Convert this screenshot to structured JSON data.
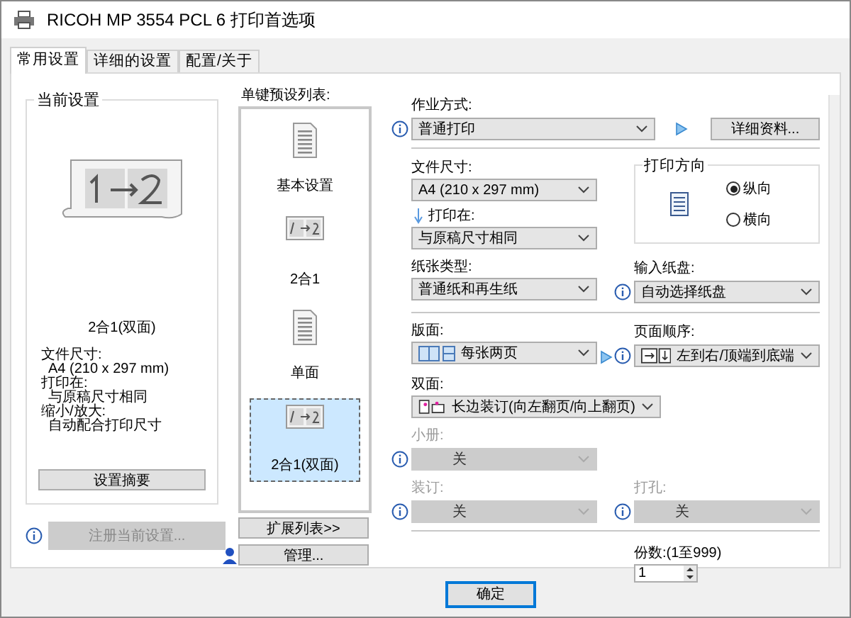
{
  "window": {
    "title": "RICOH MP 3554 PCL 6 打印首选项"
  },
  "tabs": [
    {
      "label": "常用设置",
      "selected": true
    },
    {
      "label": "详细的设置",
      "selected": false
    },
    {
      "label": "配置/关于",
      "selected": false
    }
  ],
  "current_settings": {
    "title": "当前设置",
    "caption": "2合1(双面)",
    "details": [
      {
        "label": "文件尺寸:",
        "value": "A4 (210 x 297 mm)"
      },
      {
        "label": "打印在:",
        "value": "与原稿尺寸相同"
      },
      {
        "label": "缩小/放大:",
        "value": "自动配合打印尺寸"
      }
    ],
    "summary_button": "设置摘要"
  },
  "register_button": {
    "label": "注册当前设置...",
    "disabled": true
  },
  "preset_list": {
    "title": "单键预设列表:",
    "items": [
      {
        "label": "基本设置",
        "kind": "document",
        "selected": false
      },
      {
        "label": "2合1",
        "kind": "two-up",
        "selected": false
      },
      {
        "label": "单面",
        "kind": "single",
        "selected": false
      },
      {
        "label": "2合1(双面)",
        "kind": "two-up-duplex",
        "selected": true
      }
    ]
  },
  "list_buttons": [
    "扩展列表>>",
    "管理..."
  ],
  "job_type": {
    "label": "作业方式:",
    "value": "普通打印",
    "button": "详细资料..."
  },
  "paper_size": {
    "label": "文件尺寸:",
    "value": "A4 (210 x 297 mm)"
  },
  "print_on": {
    "label": "打印在:",
    "value": "与原稿尺寸相同"
  },
  "orientation": {
    "title": "打印方向",
    "options": [
      {
        "label": "纵向",
        "selected": true
      },
      {
        "label": "横向",
        "selected": false
      }
    ]
  },
  "paper_type": {
    "label": "纸张类型:",
    "value": "普通纸和再生纸"
  },
  "input_tray": {
    "label": "输入纸盘:",
    "value": "自动选择纸盘"
  },
  "layout": {
    "label": "版面:",
    "value": "每张两页"
  },
  "page_order": {
    "label": "页面顺序:",
    "value": "左到右/顶端到底端"
  },
  "duplex": {
    "label": "双面:",
    "value": "长边装订(向左翻页/向上翻页)"
  },
  "booklet": {
    "label": "小册:",
    "value": "关",
    "disabled": true
  },
  "staple": {
    "label": "装订:",
    "value": "关",
    "disabled": true
  },
  "punch": {
    "label": "打孔:",
    "value": "关",
    "disabled": true
  },
  "copies": {
    "label": "份数:(1至999)",
    "value": "1"
  },
  "ok_button": "确定"
}
